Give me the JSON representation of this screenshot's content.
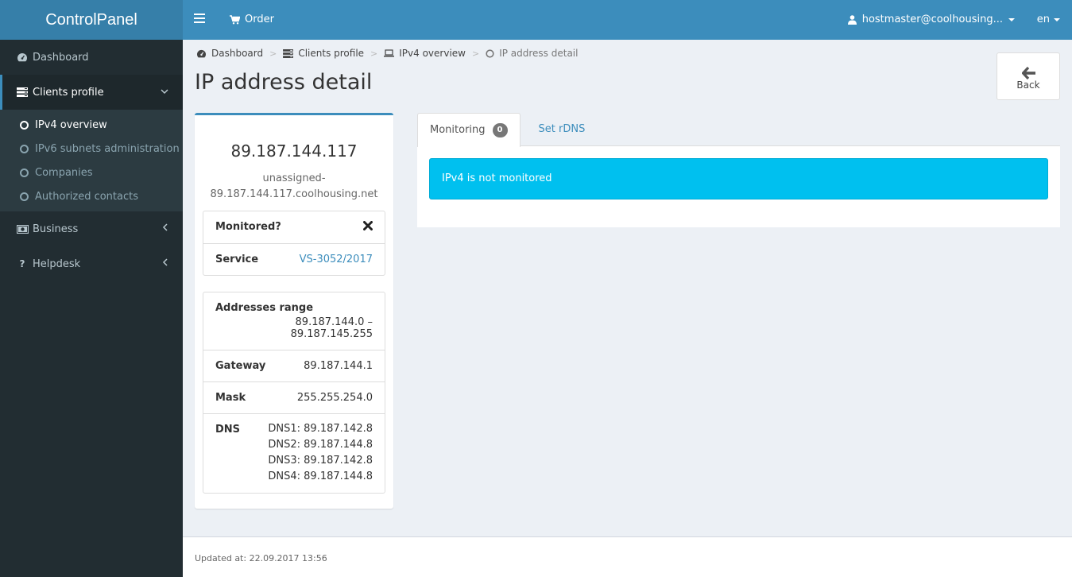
{
  "header": {
    "app_title": "ControlPanel",
    "menu_icon": "hamburger-icon",
    "order_label": "Order",
    "order_icon": "cart-icon",
    "user_label": "hostmaster@coolhousing...",
    "user_icon": "user-icon",
    "lang_label": "en"
  },
  "sidebar": {
    "items": [
      {
        "label": "Dashboard",
        "icon": "dashboard-icon"
      },
      {
        "label": "Clients profile",
        "icon": "server-icon",
        "active": true,
        "expanded": true
      },
      {
        "label": "Business",
        "icon": "money-icon"
      },
      {
        "label": "Helpdesk",
        "icon": "question-icon"
      }
    ],
    "clients_profile_sub": [
      {
        "label": "IPv4 overview",
        "active": true
      },
      {
        "label": "IPv6 subnets administration"
      },
      {
        "label": "Companies"
      },
      {
        "label": "Authorized contacts"
      }
    ]
  },
  "breadcrumb": [
    {
      "label": "Dashboard",
      "icon": "dashboard-icon"
    },
    {
      "label": "Clients profile",
      "icon": "server-icon"
    },
    {
      "label": "IPv4 overview",
      "icon": "laptop-icon"
    },
    {
      "label": "IP address detail",
      "icon": "circle-icon"
    }
  ],
  "breadcrumb_separator": ">",
  "page": {
    "title": "IP address detail",
    "back_label": "Back"
  },
  "ip_card": {
    "ip": "89.187.144.117",
    "hostname_line1": "unassigned-",
    "hostname_line2": "89.187.144.117.coolhousing.net",
    "monitored_label": "Monitored?",
    "monitored_value": "no",
    "service_label": "Service",
    "service_value": "VS-3052/2017",
    "range_label": "Addresses range",
    "range_value": "89.187.144.0 – 89.187.145.255",
    "gateway_label": "Gateway",
    "gateway_value": "89.187.144.1",
    "mask_label": "Mask",
    "mask_value": "255.255.254.0",
    "dns_label": "DNS",
    "dns": [
      "DNS1: 89.187.142.8",
      "DNS2: 89.187.144.8",
      "DNS3: 89.187.142.8",
      "DNS4: 89.187.144.8"
    ]
  },
  "tabs": [
    {
      "label": "Monitoring",
      "badge": "0",
      "active": true
    },
    {
      "label": "Set rDNS"
    }
  ],
  "alert": {
    "text": "IPv4 is not monitored",
    "color": "#00c0ef"
  },
  "footer": {
    "text": "Updated at: 22.09.2017 13:56"
  },
  "colors": {
    "primary": "#3c8dbc",
    "logo_bg": "#367fa9",
    "sidebar_bg": "#222d32",
    "info": "#00c0ef"
  }
}
